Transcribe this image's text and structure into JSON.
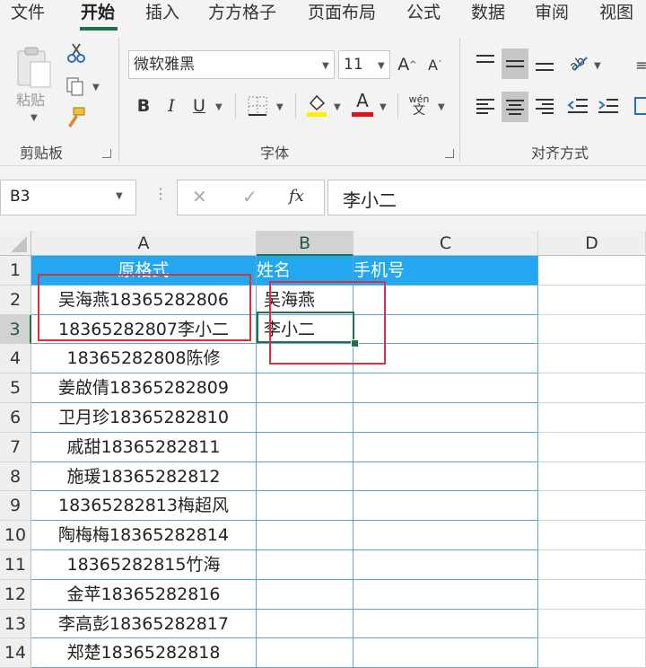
{
  "menu": {
    "tabs": [
      "文件",
      "开始",
      "插入",
      "方方格子",
      "页面布局",
      "公式",
      "数据",
      "审阅",
      "视图"
    ],
    "active_tab": "开始"
  },
  "ribbon": {
    "clipboard": {
      "label": "剪贴板",
      "paste_label": "粘贴"
    },
    "font": {
      "label": "字体",
      "font_name": "微软雅黑",
      "font_size": "11",
      "bold": "B",
      "italic": "I",
      "underline": "U",
      "pinyin_top": "wén",
      "pinyin_bottom": "文",
      "font_color_letter": "A",
      "grow_label": "A",
      "shrink_label": "A"
    },
    "alignment": {
      "label": "对齐方式"
    }
  },
  "formula_bar": {
    "name_box": "B3",
    "fx_label": "fx",
    "content": "李小二"
  },
  "sheet": {
    "columns": [
      "A",
      "B",
      "C",
      "D"
    ],
    "rows": [
      "1",
      "2",
      "3",
      "4",
      "5",
      "6",
      "7",
      "8",
      "9",
      "10",
      "11",
      "12",
      "13",
      "14"
    ],
    "headers": [
      "原格式",
      "姓名",
      "手机号"
    ],
    "col_a": [
      "吴海燕18365282806",
      "18365282807李小二",
      "18365282808陈修",
      "姜啟倩18365282809",
      "卫月珍18365282810",
      "戚甜18365282811",
      "施瑗18365282812",
      "18365282813梅超风",
      "陶梅梅18365282814",
      "18365282815竹海",
      "金苹18365282816",
      "李高彭18365282817",
      "郑楚18365282818"
    ],
    "col_b": [
      "吴海燕",
      "李小二"
    ],
    "selected_cell": "B3",
    "header_color": "#22a7f0",
    "highlight_box_color": "#d6343c",
    "accent_color": "#217346"
  }
}
